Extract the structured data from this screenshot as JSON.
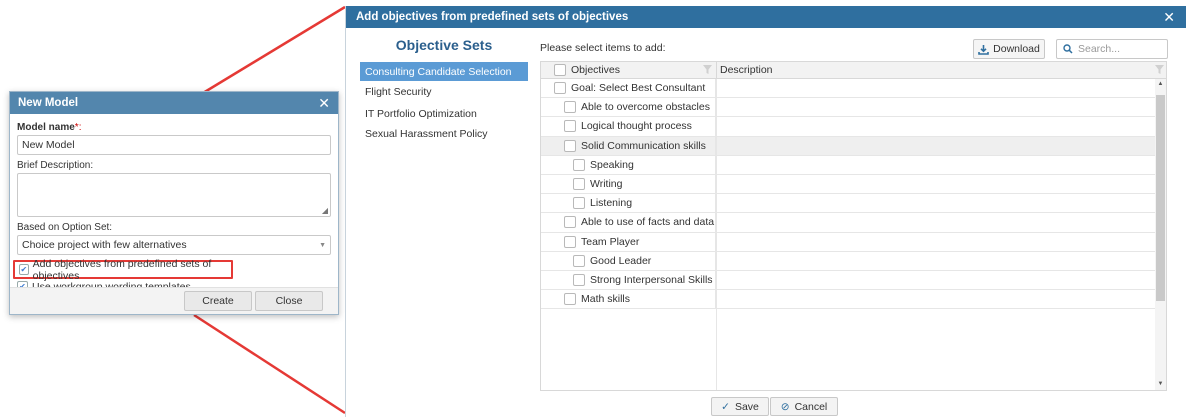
{
  "new_model_dialog": {
    "title": "New Model",
    "model_name_label": "Model name",
    "required_mark": "*:",
    "model_name_value": "New Model",
    "brief_description_label": "Brief Description:",
    "option_set_label": "Based on Option Set:",
    "option_set_value": "Choice project with few alternatives",
    "add_objectives_label": "Add objectives from predefined sets of objectives",
    "add_objectives_checked": true,
    "workgroup_label": "Use workgroup wording templates",
    "workgroup_checked": true,
    "create_label": "Create",
    "close_label": "Close"
  },
  "objectives_dialog": {
    "title": "Add objectives from predefined sets of objectives",
    "sets_heading": "Objective Sets",
    "sets": [
      {
        "label": "Consulting Candidate Selection",
        "active": true
      },
      {
        "label": "Flight Security",
        "active": false
      },
      {
        "label": "IT Portfolio Optimization",
        "active": false
      },
      {
        "label": "Sexual Harassment Policy",
        "active": false
      }
    ],
    "prompt": "Please select items to add:",
    "download_label": "Download",
    "search_placeholder": "Search...",
    "columns": [
      "Objectives",
      "Description"
    ],
    "rows": [
      {
        "label": "Goal: Select Best Consultant",
        "level": 0
      },
      {
        "label": "Able to overcome obstacles",
        "level": 1
      },
      {
        "label": "Logical thought process",
        "level": 1
      },
      {
        "label": "Solid Communication skills",
        "level": 1,
        "selected": true
      },
      {
        "label": "Speaking",
        "level": 2
      },
      {
        "label": "Writing",
        "level": 2
      },
      {
        "label": "Listening",
        "level": 2
      },
      {
        "label": "Able to use of facts and data",
        "level": 1
      },
      {
        "label": "Team Player",
        "level": 1
      },
      {
        "label": "Good Leader",
        "level": 2
      },
      {
        "label": "Strong Interpersonal Skills",
        "level": 2
      },
      {
        "label": "Math skills",
        "level": 1
      }
    ],
    "save_label": "Save",
    "cancel_label": "Cancel"
  },
  "colors": {
    "title_bar_small": "#5386ad",
    "title_bar_large": "#2f6f9f",
    "active_set": "#5b9bd5",
    "highlight_box": "#e53935",
    "connector": "#e53935"
  }
}
